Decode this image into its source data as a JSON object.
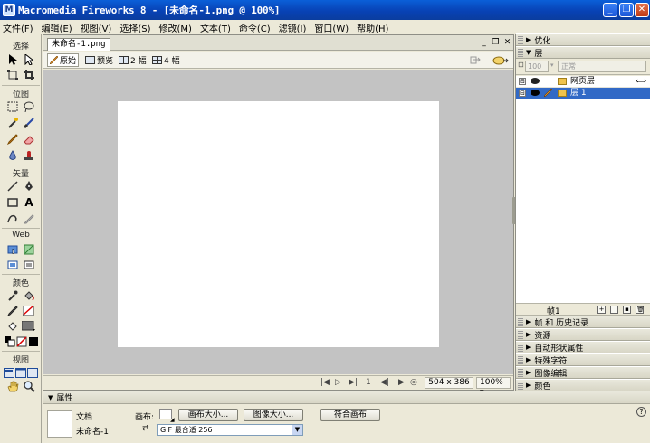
{
  "window": {
    "app_icon_glyph": "M",
    "title": "Macromedia Fireworks 8 - [未命名-1.png @ 100%]",
    "minimize": "_",
    "maximize": "❐",
    "close": "✕"
  },
  "menu": [
    "文件(F)",
    "编辑(E)",
    "视图(V)",
    "选择(S)",
    "修改(M)",
    "文本(T)",
    "命令(C)",
    "滤镜(I)",
    "窗口(W)",
    "帮助(H)"
  ],
  "tools": {
    "sections": [
      "选择",
      "位图",
      "矢量",
      "Web",
      "颜色",
      "视图"
    ],
    "icons": {
      "pointer": "pointer-icon",
      "subselect": "subselect-icon",
      "scale": "scale-icon",
      "crop": "crop-icon",
      "marquee": "marquee-icon",
      "lasso": "lasso-icon",
      "magic-wand": "magic-wand-icon",
      "brush": "brush-icon",
      "pencil": "pencil-icon",
      "eraser": "eraser-icon",
      "blur": "blur-icon",
      "rubber-stamp": "rubber-stamp-icon",
      "line": "line-icon",
      "pen": "pen-icon",
      "rectangle": "rectangle-icon",
      "text": "text-icon",
      "freeform": "freeform-icon",
      "knife": "knife-icon",
      "hotspot": "hotspot-icon",
      "slice": "slice-icon",
      "hide-slices": "hide-slices-icon",
      "show-slices": "show-slices-icon",
      "eyedropper": "eyedropper-icon",
      "paint-bucket": "paint-bucket-icon",
      "stroke-color": "stroke-color-icon",
      "fill-color": "fill-color-icon",
      "hand": "hand-icon",
      "zoom": "zoom-icon"
    },
    "text_tool_glyph": "A"
  },
  "document": {
    "tab": "未命名-1.png",
    "views": [
      {
        "label": "原始",
        "active": true
      },
      {
        "label": "预览",
        "active": false
      },
      {
        "label": "2 幅",
        "active": false
      },
      {
        "label": "4 幅",
        "active": false
      }
    ],
    "status": {
      "frame": "1",
      "size": "504 x 386",
      "zoom": "100%"
    }
  },
  "panels": {
    "optimize": "优化",
    "layers": {
      "title": "层",
      "opacity": "100",
      "blend": "正常",
      "rows": [
        {
          "name": "网页层",
          "expand": "⊟",
          "selected": false
        },
        {
          "name": "层 1",
          "expand": "⊟",
          "selected": true
        }
      ],
      "frame_label": "帧1"
    },
    "collapsed": [
      "帧 和 历史记录",
      "资源",
      "自动形状属性",
      "特殊字符",
      "图像编辑",
      "颜色"
    ]
  },
  "properties": {
    "title": "属性",
    "doc_type": "文档",
    "doc_name": "未命名-1",
    "canvas_label": "画布:",
    "canvas_size_button": "画布大小...",
    "image_size_button": "图像大小...",
    "fit_canvas_button": "符合画布",
    "export_format": "GIF 最合适 256",
    "help_glyph": "?"
  },
  "colors": {
    "title_bar": "#0842b5",
    "selection": "#3169c6",
    "canvas_bg": "#c3c3c3",
    "canvas": "#ffffff"
  }
}
